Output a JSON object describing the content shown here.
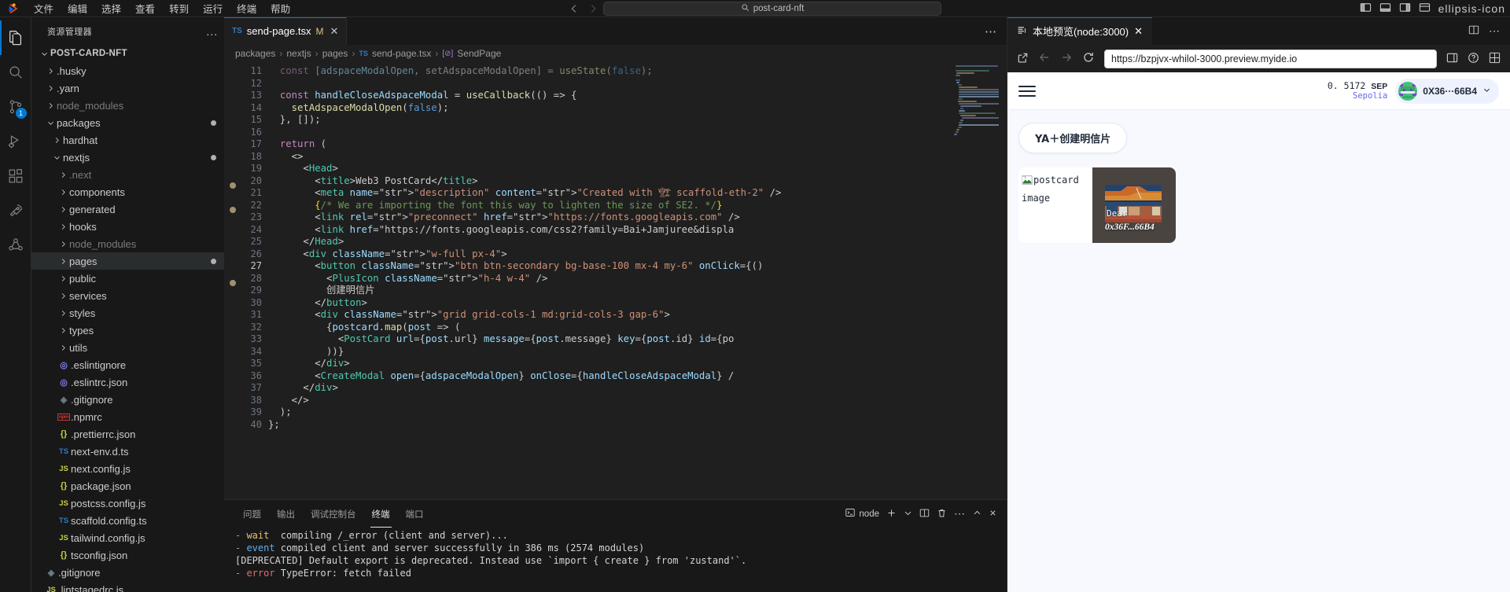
{
  "titlebar": {
    "menu": [
      "文件",
      "编辑",
      "选择",
      "查看",
      "转到",
      "运行",
      "终端",
      "帮助"
    ],
    "search_placeholder": "post-card-nft",
    "search_icon": "search-icon",
    "back_icon": "arrow-left-icon",
    "forward_icon": "arrow-right-icon",
    "layout_icons": [
      "panel-left-icon",
      "panel-bottom-icon",
      "panel-right-icon",
      "layout-icon"
    ],
    "more_icon": "ellipsis-icon"
  },
  "activitybar": {
    "items": [
      {
        "name": "explorer",
        "icon": "files-icon",
        "badge": ""
      },
      {
        "name": "search",
        "icon": "search-icon",
        "badge": ""
      },
      {
        "name": "source-control",
        "icon": "source-control-icon",
        "badge": "1"
      },
      {
        "name": "run-debug",
        "icon": "debug-icon",
        "badge": ""
      },
      {
        "name": "extensions",
        "icon": "extensions-icon",
        "badge": ""
      },
      {
        "name": "remote",
        "icon": "rocket-icon",
        "badge": ""
      },
      {
        "name": "share",
        "icon": "share-icon",
        "badge": ""
      }
    ]
  },
  "explorer": {
    "title": "资源管理器",
    "more_label": "...",
    "tree": [
      {
        "label": "POST-CARD-NFT",
        "depth": 0,
        "type": "root",
        "expanded": true,
        "icon": "chevron-down-icon"
      },
      {
        "label": ".husky",
        "depth": 1,
        "type": "folder",
        "expanded": false,
        "icon": "chevron-right-icon"
      },
      {
        "label": ".yarn",
        "depth": 1,
        "type": "folder",
        "expanded": false,
        "icon": "chevron-right-icon"
      },
      {
        "label": "node_modules",
        "depth": 1,
        "type": "folder-dim",
        "expanded": false,
        "icon": "chevron-right-icon"
      },
      {
        "label": "packages",
        "depth": 1,
        "type": "folder",
        "expanded": true,
        "icon": "chevron-down-icon",
        "modified": true
      },
      {
        "label": "hardhat",
        "depth": 2,
        "type": "folder",
        "expanded": false,
        "icon": "chevron-right-icon"
      },
      {
        "label": "nextjs",
        "depth": 2,
        "type": "folder",
        "expanded": true,
        "icon": "chevron-down-icon",
        "modified": true
      },
      {
        "label": ".next",
        "depth": 3,
        "type": "folder-dim",
        "expanded": false,
        "icon": "chevron-right-icon"
      },
      {
        "label": "components",
        "depth": 3,
        "type": "folder",
        "expanded": false,
        "icon": "chevron-right-icon"
      },
      {
        "label": "generated",
        "depth": 3,
        "type": "folder",
        "expanded": false,
        "icon": "chevron-right-icon"
      },
      {
        "label": "hooks",
        "depth": 3,
        "type": "folder",
        "expanded": false,
        "icon": "chevron-right-icon"
      },
      {
        "label": "node_modules",
        "depth": 3,
        "type": "folder-dim",
        "expanded": false,
        "icon": "chevron-right-icon"
      },
      {
        "label": "pages",
        "depth": 3,
        "type": "folder",
        "expanded": false,
        "icon": "chevron-right-icon",
        "selected": true,
        "modified": true
      },
      {
        "label": "public",
        "depth": 3,
        "type": "folder",
        "expanded": false,
        "icon": "chevron-right-icon"
      },
      {
        "label": "services",
        "depth": 3,
        "type": "folder",
        "expanded": false,
        "icon": "chevron-right-icon"
      },
      {
        "label": "styles",
        "depth": 3,
        "type": "folder",
        "expanded": false,
        "icon": "chevron-right-icon"
      },
      {
        "label": "types",
        "depth": 3,
        "type": "folder",
        "expanded": false,
        "icon": "chevron-right-icon"
      },
      {
        "label": "utils",
        "depth": 3,
        "type": "folder",
        "expanded": false,
        "icon": "chevron-right-icon"
      },
      {
        "label": ".eslintignore",
        "depth": 3,
        "type": "file",
        "badge": "eslint-icon"
      },
      {
        "label": ".eslintrc.json",
        "depth": 3,
        "type": "file",
        "badge": "eslint-icon"
      },
      {
        "label": ".gitignore",
        "depth": 3,
        "type": "file",
        "badge": "git-icon"
      },
      {
        "label": ".npmrc",
        "depth": 3,
        "type": "file",
        "badge": "npm-icon"
      },
      {
        "label": ".prettierrc.json",
        "depth": 3,
        "type": "file",
        "badge": "json-icon"
      },
      {
        "label": "next-env.d.ts",
        "depth": 3,
        "type": "file",
        "badge": "ts-icon"
      },
      {
        "label": "next.config.js",
        "depth": 3,
        "type": "file",
        "badge": "js-icon"
      },
      {
        "label": "package.json",
        "depth": 3,
        "type": "file",
        "badge": "json-icon"
      },
      {
        "label": "postcss.config.js",
        "depth": 3,
        "type": "file",
        "badge": "js-icon"
      },
      {
        "label": "scaffold.config.ts",
        "depth": 3,
        "type": "file",
        "badge": "ts-icon"
      },
      {
        "label": "tailwind.config.js",
        "depth": 3,
        "type": "file",
        "badge": "js-icon"
      },
      {
        "label": "tsconfig.json",
        "depth": 3,
        "type": "file",
        "badge": "json-icon"
      },
      {
        "label": ".gitignore",
        "depth": 1,
        "type": "file",
        "badge": "git-icon"
      },
      {
        "label": ".lintstagedrc.js",
        "depth": 1,
        "type": "file",
        "badge": "js-icon"
      }
    ]
  },
  "editor": {
    "tab": {
      "label": "send-page.tsx",
      "lang_badge": "TS",
      "modified_badge": "M",
      "close_icon": "close-icon"
    },
    "tabs_more_icon": "ellipsis-icon",
    "breadcrumb": [
      "packages",
      "nextjs",
      "pages",
      "send-page.tsx",
      "SendPage"
    ],
    "breadcrumb_file_badge": "TS",
    "breadcrumb_symbol_badge": "method-icon",
    "first_line": 11,
    "cursor_line": 27,
    "lines": [
      {
        "n": 11,
        "text": "  const [adspaceModalOpen, setAdspaceModalOpen] = useState(false);",
        "clipped_top": true
      },
      {
        "n": 12,
        "text": ""
      },
      {
        "n": 13,
        "text": "  const handleCloseAdspaceModal = useCallback(() => {"
      },
      {
        "n": 14,
        "text": "    setAdspaceModalOpen(false);"
      },
      {
        "n": 15,
        "text": "  }, []);"
      },
      {
        "n": 16,
        "text": ""
      },
      {
        "n": 17,
        "text": "  return ("
      },
      {
        "n": 18,
        "text": "    <>"
      },
      {
        "n": 19,
        "text": "      <Head>"
      },
      {
        "n": 20,
        "text": "        <title>Web3 PostCard</title>"
      },
      {
        "n": 21,
        "text": "        <meta name=\"description\" content=\"Created with 🏗 scaffold-eth-2\" />"
      },
      {
        "n": 22,
        "text": "        {/* We are importing the font this way to lighten the size of SE2. */}"
      },
      {
        "n": 23,
        "text": "        <link rel=\"preconnect\" href=\"https://fonts.googleapis.com\" />"
      },
      {
        "n": 24,
        "text": "        <link href=\"https://fonts.googleapis.com/css2?family=Bai+Jamjuree&displa"
      },
      {
        "n": 25,
        "text": "      </Head>"
      },
      {
        "n": 26,
        "text": "      <div className=\"w-full px-4\">"
      },
      {
        "n": 27,
        "text": "        <button className=\"btn btn-secondary bg-base-100 mx-4 my-6\" onClick={()"
      },
      {
        "n": 28,
        "text": "          <PlusIcon className=\"h-4 w-4\" />"
      },
      {
        "n": 29,
        "text": "          创建明信片"
      },
      {
        "n": 30,
        "text": "        </button>"
      },
      {
        "n": 31,
        "text": "        <div className=\"grid grid-cols-1 md:grid-cols-3 gap-6\">"
      },
      {
        "n": 32,
        "text": "          {postcard.map(post => ("
      },
      {
        "n": 33,
        "text": "            <PostCard url={post.url} message={post.message} key={post.id} id={po"
      },
      {
        "n": 34,
        "text": "          ))}"
      },
      {
        "n": 35,
        "text": "        </div>"
      },
      {
        "n": 36,
        "text": "        <CreateModal open={adspaceModalOpen} onClose={handleCloseAdspaceModal} /"
      },
      {
        "n": 37,
        "text": "      </div>"
      },
      {
        "n": 38,
        "text": "    </>"
      },
      {
        "n": 39,
        "text": "  );"
      },
      {
        "n": 40,
        "text": "};"
      }
    ]
  },
  "panel": {
    "tabs": [
      "问题",
      "输出",
      "调试控制台",
      "终端",
      "端口"
    ],
    "active_tab": "终端",
    "node_chip": "node",
    "actions": [
      "add-terminal-icon",
      "chevron-down-icon",
      "split-terminal-icon",
      "trash-icon",
      "ellipsis-icon",
      "chevron-up-icon",
      "close-icon"
    ],
    "terminal_lines": [
      {
        "segments": [
          {
            "t": "- ",
            "c": "t-grey"
          },
          {
            "t": "wait",
            "c": "t-y"
          },
          {
            "t": "  compiling /_error (client and server)...",
            "c": "t-w"
          }
        ]
      },
      {
        "segments": [
          {
            "t": "- ",
            "c": "t-grey"
          },
          {
            "t": "event",
            "c": "t-b"
          },
          {
            "t": " compiled client and server successfully in 386 ms (2574 modules)",
            "c": "t-w"
          }
        ]
      },
      {
        "segments": [
          {
            "t": "[DEPRECATED] Default export is deprecated. Instead use `import { create } from 'zustand'`.",
            "c": "t-w"
          }
        ]
      },
      {
        "segments": [
          {
            "t": "- ",
            "c": "t-grey"
          },
          {
            "t": "error",
            "c": "t-r"
          },
          {
            "t": " TypeError: fetch failed",
            "c": "t-w"
          }
        ]
      }
    ]
  },
  "preview": {
    "tab": {
      "label": "本地预览(node:3000)",
      "icon": "preview-icon",
      "close_icon": "close-icon"
    },
    "tab_actions": [
      "split-editor-icon",
      "ellipsis-icon"
    ],
    "toolbar": {
      "open_external_icon": "external-link-icon",
      "back_icon": "arrow-left-icon",
      "forward_icon": "arrow-right-icon",
      "reload_icon": "reload-icon",
      "url": "https://bzpjvx-whilol-3000.preview.myide.io",
      "devtools_icon": "devtools-icon",
      "help_icon": "help-icon",
      "grid_icon": "grid-icon"
    },
    "site": {
      "menu_icon": "hamburger-icon",
      "balance": "0. 5172",
      "balance_unit": "SEP",
      "network": "Sepolia",
      "address": "0X36···66B4",
      "address_caret_icon": "chevron-down-icon",
      "avatar_icon": "blockie-avatar",
      "create_button": "YA＋创建明信片",
      "broken_image_alt": "postcard image",
      "broken_image_icon": "broken-image-icon",
      "card_greeting": "Dear",
      "card_address": "0x36F...66B4"
    }
  },
  "colors": {
    "accent": "#0078d4",
    "modified": "#e2c08d",
    "ts_blue": "#3178c6",
    "js_yellow": "#cbcb41",
    "wallet_chip_bg": "#eef2ff",
    "network_purple": "#6366f1"
  }
}
